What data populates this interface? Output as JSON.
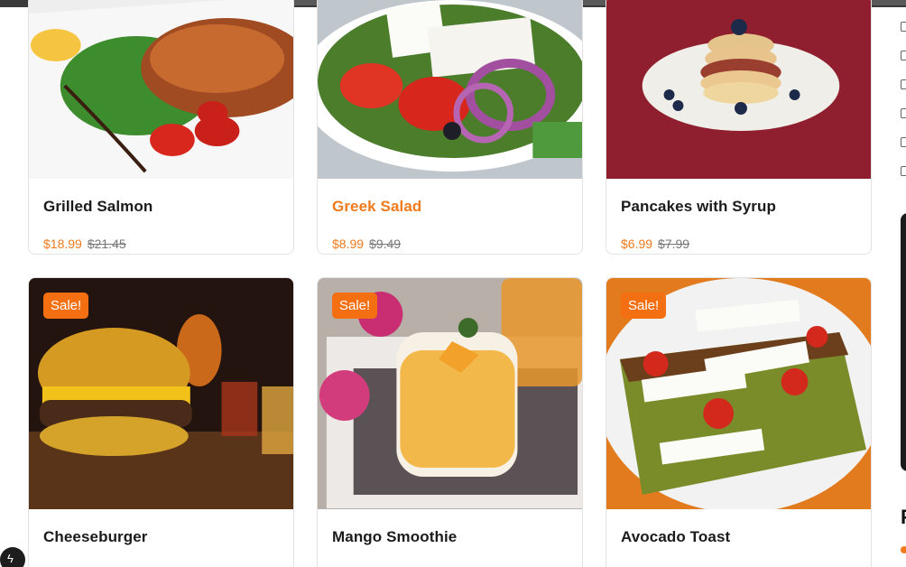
{
  "products": [
    {
      "name": "Grilled Salmon",
      "price": "$18.99",
      "old_price": "$21.45"
    },
    {
      "name": "Greek Salad",
      "price": "$8.99",
      "old_price": "$9.49"
    },
    {
      "name": "Pancakes with Syrup",
      "price": "$6.99",
      "old_price": "$7.99"
    },
    {
      "name": "Cheeseburger",
      "badge": "Sale!"
    },
    {
      "name": "Mango Smoothie",
      "badge": "Sale!"
    },
    {
      "name": "Avocado Toast",
      "badge": "Sale!"
    }
  ],
  "sidebar": {
    "heading_partial": "F"
  },
  "fab": {
    "icon": "bolt-icon"
  },
  "colors": {
    "accent": "#f07a1c",
    "badge": "#f36f12"
  }
}
